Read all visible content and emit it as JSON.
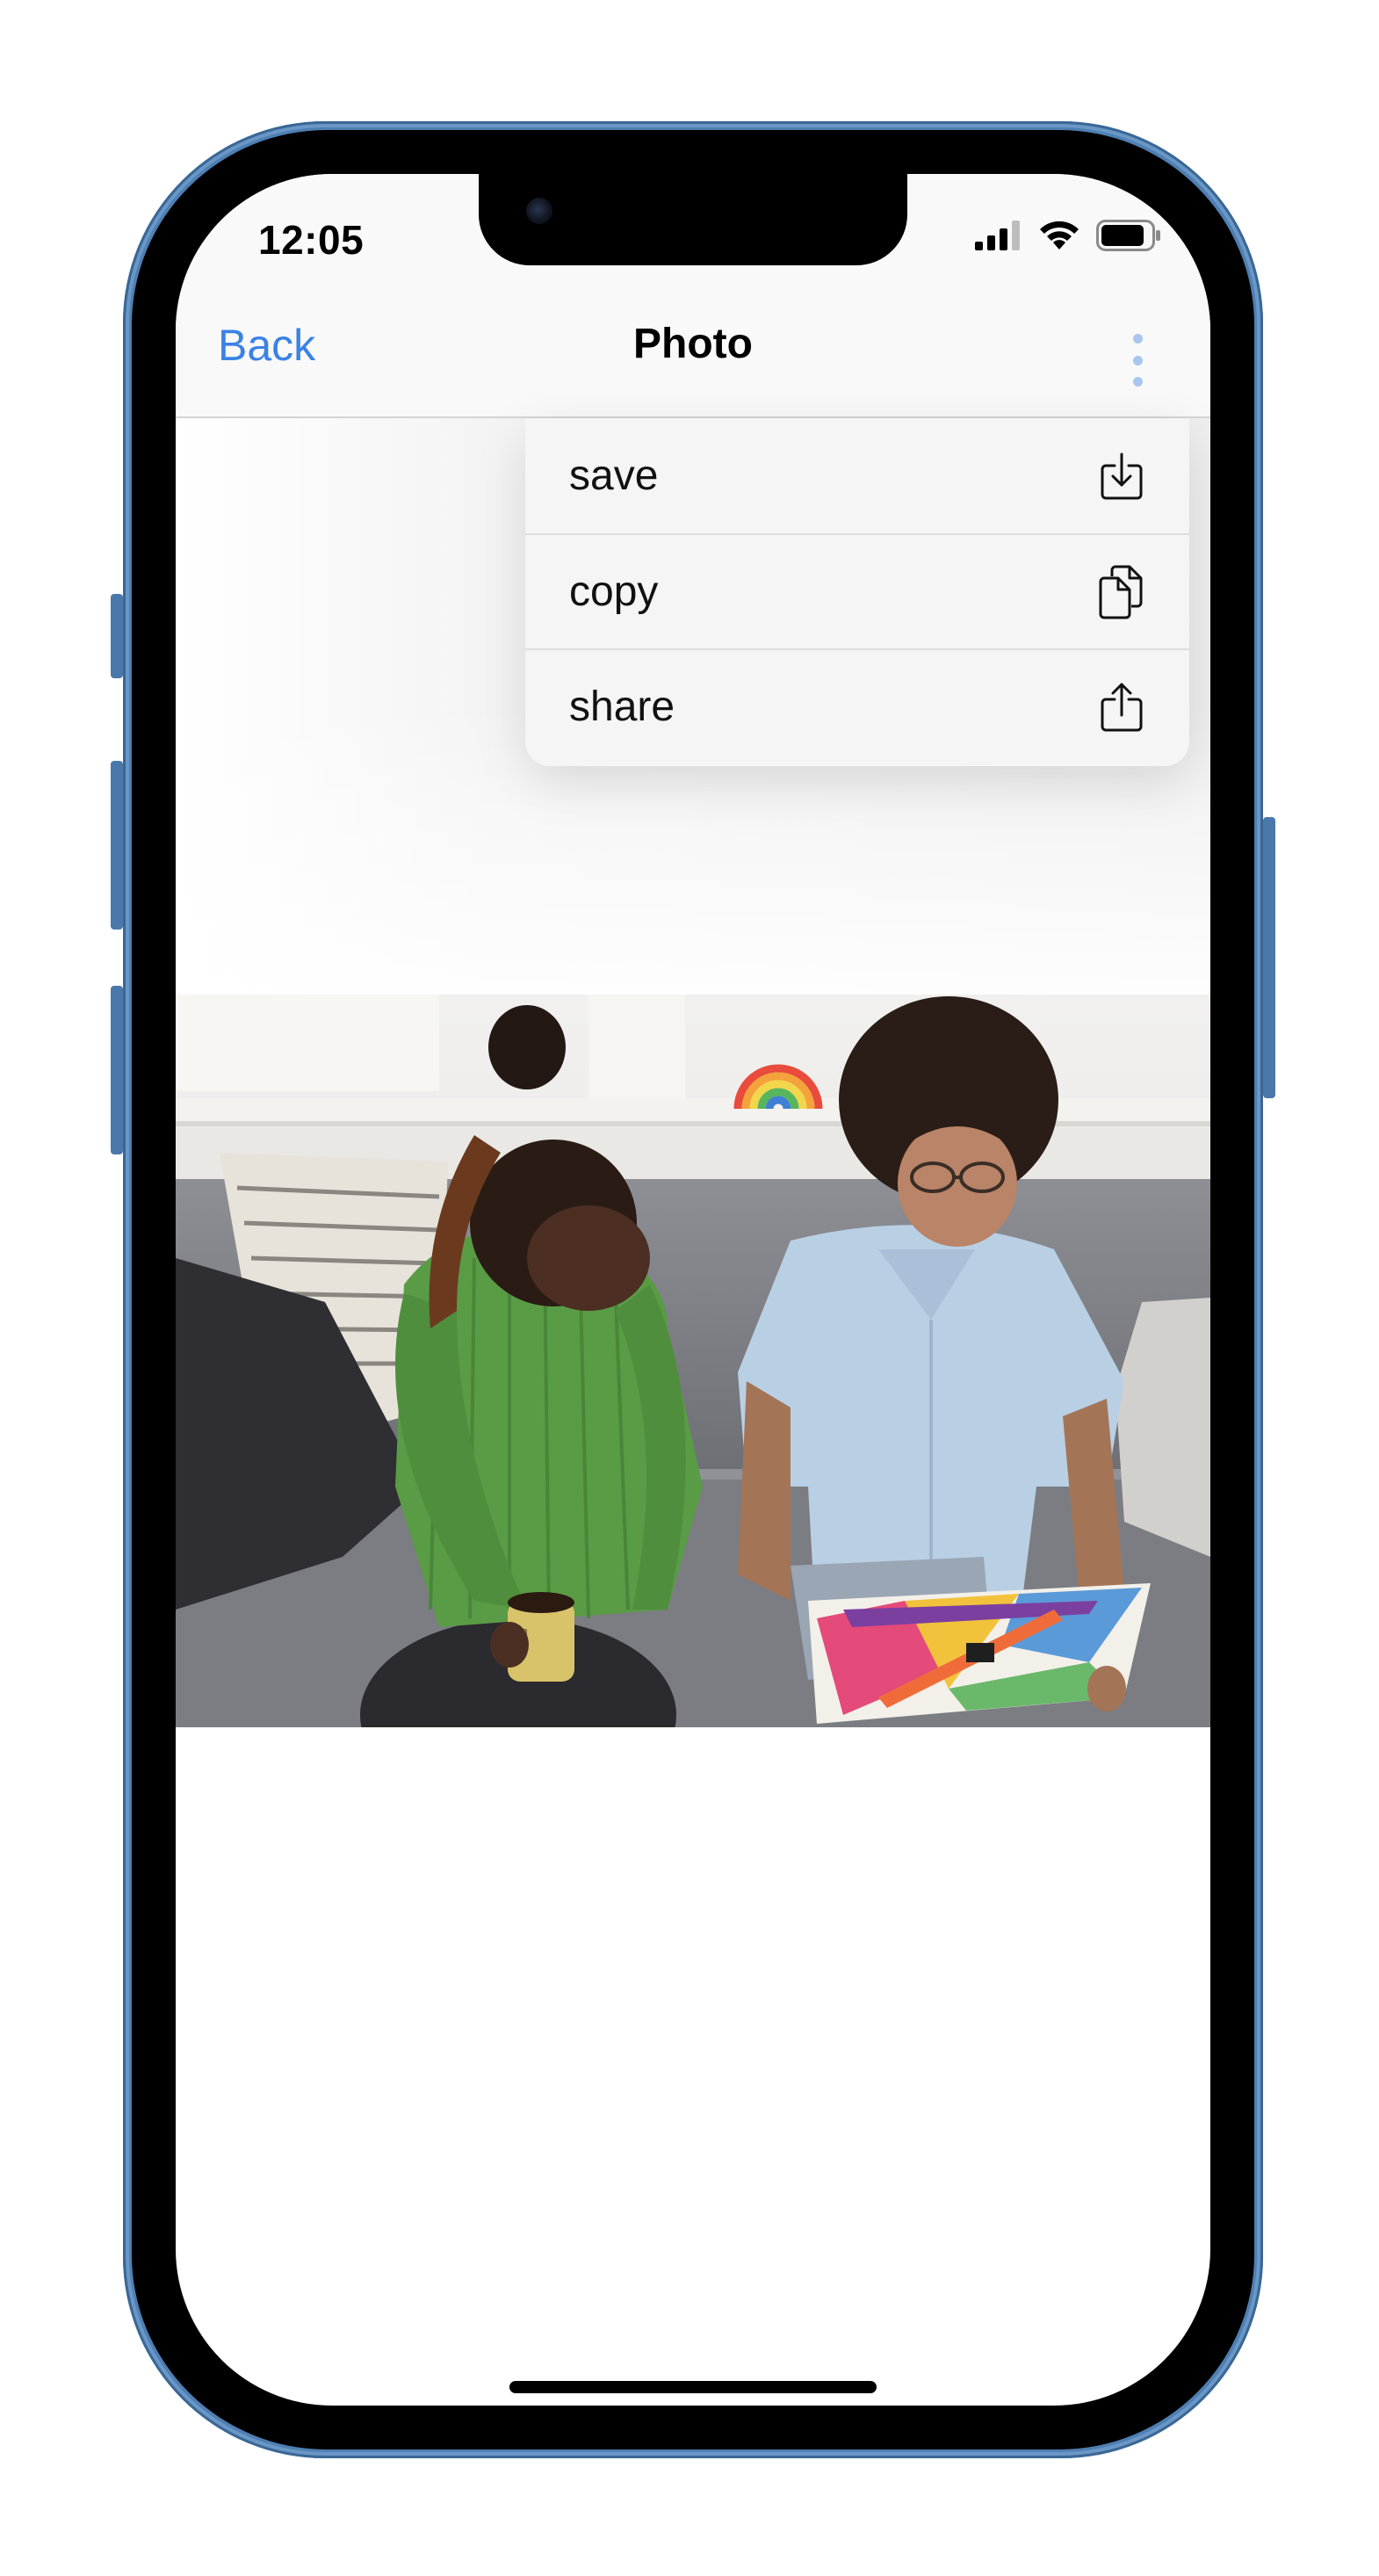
{
  "status_bar": {
    "time": "12:05"
  },
  "nav": {
    "back_label": "Back",
    "title": "Photo"
  },
  "menu": {
    "items": [
      {
        "label": "save",
        "icon": "save-download-icon"
      },
      {
        "label": "copy",
        "icon": "copy-documents-icon"
      },
      {
        "label": "share",
        "icon": "share-upload-icon"
      }
    ]
  },
  "colors": {
    "accent": "#3a82e6",
    "more_dots": "#a9c6ee",
    "frame": "#4e7fb3"
  }
}
